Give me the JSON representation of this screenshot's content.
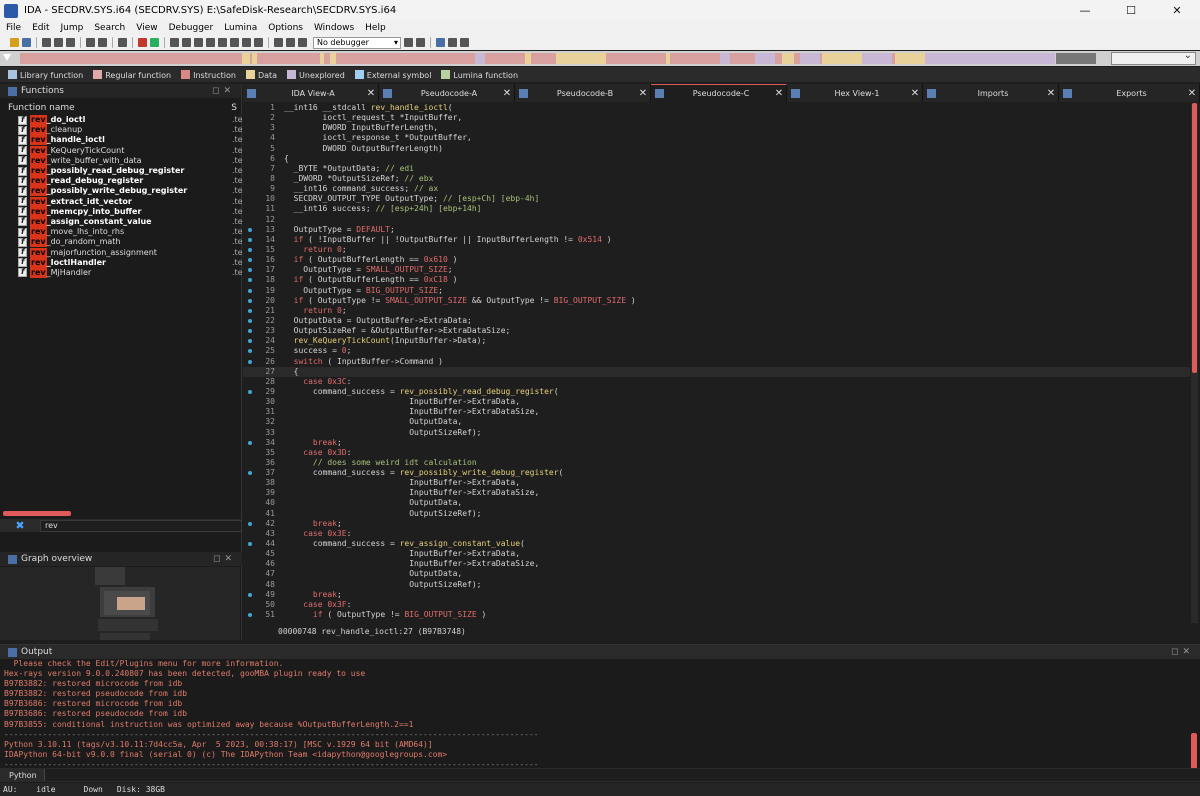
{
  "window": {
    "title": "IDA - SECDRV.SYS.i64 (SECDRV.SYS) E:\\SafeDisk-Research\\SECDRV.SYS.i64",
    "minimize": "—",
    "maximize": "☐",
    "close": "✕"
  },
  "menu": [
    "File",
    "Edit",
    "Jump",
    "Search",
    "View",
    "Debugger",
    "Lumina",
    "Options",
    "Windows",
    "Help"
  ],
  "toolbar": {
    "debugger_select": "No debugger"
  },
  "legend": [
    {
      "label": "Library function",
      "color": "#a9c4e0"
    },
    {
      "label": "Regular function",
      "color": "#e0a8a8"
    },
    {
      "label": "Instruction",
      "color": "#d88a86"
    },
    {
      "label": "Data",
      "color": "#e8d29a"
    },
    {
      "label": "Unexplored",
      "color": "#c9b7d6"
    },
    {
      "label": "External symbol",
      "color": "#9fd0f0"
    },
    {
      "label": "Lumina function",
      "color": "#b7d3a0"
    }
  ],
  "functions_pane": {
    "title": "Functions",
    "col_name": "Function name",
    "col_segment": "S",
    "filter_text": "rev",
    "items": [
      {
        "prefix": "rev",
        "rest": "_do_ioctl",
        "bold": true,
        "seg": ".te"
      },
      {
        "prefix": "rev",
        "rest": "_cleanup",
        "bold": false,
        "seg": ".te"
      },
      {
        "prefix": "rev",
        "rest": "_handle_ioctl",
        "bold": true,
        "seg": ".te"
      },
      {
        "prefix": "rev",
        "rest": "_KeQueryTickCount",
        "bold": false,
        "seg": ".te"
      },
      {
        "prefix": "rev",
        "rest": "_write_buffer_with_data",
        "bold": false,
        "seg": ".te"
      },
      {
        "prefix": "rev",
        "rest": "_possibly_read_debug_register",
        "bold": true,
        "seg": ".te"
      },
      {
        "prefix": "rev",
        "rest": "_read_debug_register",
        "bold": true,
        "seg": ".te"
      },
      {
        "prefix": "rev",
        "rest": "_possibly_write_debug_register",
        "bold": true,
        "seg": ".te"
      },
      {
        "prefix": "rev",
        "rest": "_extract_idt_vector",
        "bold": true,
        "seg": ".te"
      },
      {
        "prefix": "rev",
        "rest": "_memcpy_into_buffer",
        "bold": true,
        "seg": ".te"
      },
      {
        "prefix": "rev",
        "rest": "_assign_constant_value",
        "bold": true,
        "seg": ".te"
      },
      {
        "prefix": "rev",
        "rest": "_move_lhs_into_rhs",
        "bold": false,
        "seg": ".te"
      },
      {
        "prefix": "rev",
        "rest": "_do_random_math",
        "bold": false,
        "seg": ".te"
      },
      {
        "prefix": "rev",
        "rest": "_majorfunction_assignment",
        "bold": false,
        "seg": ".te"
      },
      {
        "prefix": "rev",
        "rest": "_IoctlHandler",
        "bold": true,
        "seg": ".te"
      },
      {
        "prefix": "rev",
        "rest": "_MjHandler",
        "bold": false,
        "seg": ".te"
      }
    ]
  },
  "graph_overview": {
    "title": "Graph overview"
  },
  "tabs": [
    {
      "label": "IDA View-A",
      "active": false
    },
    {
      "label": "Pseudocode-A",
      "active": false
    },
    {
      "label": "Pseudocode-B",
      "active": false
    },
    {
      "label": "Pseudocode-C",
      "active": true
    },
    {
      "label": "Hex View-1",
      "active": false
    },
    {
      "label": "Imports",
      "active": false
    },
    {
      "label": "Exports",
      "active": false
    }
  ],
  "code": {
    "lines": [
      {
        "n": "1",
        "dot": false,
        "t": "__int16 __stdcall rev_handle_ioctl("
      },
      {
        "n": "2",
        "dot": false,
        "t": "        ioctl_request_t *InputBuffer,"
      },
      {
        "n": "3",
        "dot": false,
        "t": "        DWORD InputBufferLength,"
      },
      {
        "n": "4",
        "dot": false,
        "t": "        ioctl_response_t *OutputBuffer,"
      },
      {
        "n": "5",
        "dot": false,
        "t": "        DWORD OutputBufferLength)"
      },
      {
        "n": "6",
        "dot": false,
        "t": "{"
      },
      {
        "n": "7",
        "dot": false,
        "t": "  _BYTE *OutputData; // edi"
      },
      {
        "n": "8",
        "dot": false,
        "t": "  _DWORD *OutputSizeRef; // ebx"
      },
      {
        "n": "9",
        "dot": false,
        "t": "  __int16 command_success; // ax"
      },
      {
        "n": "10",
        "dot": false,
        "t": "  SECDRV_OUTPUT_TYPE OutputType; // [esp+Ch] [ebp-4h]"
      },
      {
        "n": "11",
        "dot": false,
        "t": "  __int16 success; // [esp+24h] [ebp+14h]"
      },
      {
        "n": "12",
        "dot": false,
        "t": ""
      },
      {
        "n": "13",
        "dot": true,
        "t": "  OutputType = DEFAULT;"
      },
      {
        "n": "14",
        "dot": true,
        "t": "  if ( !InputBuffer || !OutputBuffer || InputBufferLength != 0x514 )"
      },
      {
        "n": "15",
        "dot": true,
        "t": "    return 0;"
      },
      {
        "n": "16",
        "dot": true,
        "t": "  if ( OutputBufferLength == 0x610 )"
      },
      {
        "n": "17",
        "dot": true,
        "t": "    OutputType = SMALL_OUTPUT_SIZE;"
      },
      {
        "n": "18",
        "dot": true,
        "t": "  if ( OutputBufferLength == 0xC18 )"
      },
      {
        "n": "19",
        "dot": true,
        "t": "    OutputType = BIG_OUTPUT_SIZE;"
      },
      {
        "n": "20",
        "dot": true,
        "t": "  if ( OutputType != SMALL_OUTPUT_SIZE && OutputType != BIG_OUTPUT_SIZE )"
      },
      {
        "n": "21",
        "dot": true,
        "t": "    return 0;"
      },
      {
        "n": "22",
        "dot": true,
        "t": "  OutputData = OutputBuffer->ExtraData;"
      },
      {
        "n": "23",
        "dot": true,
        "t": "  OutputSizeRef = &OutputBuffer->ExtraDataSize;"
      },
      {
        "n": "24",
        "dot": true,
        "t": "  rev_KeQueryTickCount(InputBuffer->Data);"
      },
      {
        "n": "25",
        "dot": true,
        "t": "  success = 0;"
      },
      {
        "n": "26",
        "dot": true,
        "t": "  switch ( InputBuffer->Command )"
      },
      {
        "n": "27",
        "dot": false,
        "t": "  {"
      },
      {
        "n": "28",
        "dot": false,
        "t": "    case 0x3C:"
      },
      {
        "n": "29",
        "dot": true,
        "t": "      command_success = rev_possibly_read_debug_register("
      },
      {
        "n": "30",
        "dot": false,
        "t": "                          InputBuffer->ExtraData,"
      },
      {
        "n": "31",
        "dot": false,
        "t": "                          InputBuffer->ExtraDataSize,"
      },
      {
        "n": "32",
        "dot": false,
        "t": "                          OutputData,"
      },
      {
        "n": "33",
        "dot": false,
        "t": "                          OutputSizeRef);"
      },
      {
        "n": "34",
        "dot": true,
        "t": "      break;"
      },
      {
        "n": "35",
        "dot": false,
        "t": "    case 0x3D:"
      },
      {
        "n": "36",
        "dot": false,
        "t": "      // does some weird idt calculation"
      },
      {
        "n": "37",
        "dot": true,
        "t": "      command_success = rev_possibly_write_debug_register("
      },
      {
        "n": "38",
        "dot": false,
        "t": "                          InputBuffer->ExtraData,"
      },
      {
        "n": "39",
        "dot": false,
        "t": "                          InputBuffer->ExtraDataSize,"
      },
      {
        "n": "40",
        "dot": false,
        "t": "                          OutputData,"
      },
      {
        "n": "41",
        "dot": false,
        "t": "                          OutputSizeRef);"
      },
      {
        "n": "42",
        "dot": true,
        "t": "      break;"
      },
      {
        "n": "43",
        "dot": false,
        "t": "    case 0x3E:"
      },
      {
        "n": "44",
        "dot": true,
        "t": "      command_success = rev_assign_constant_value("
      },
      {
        "n": "45",
        "dot": false,
        "t": "                          InputBuffer->ExtraData,"
      },
      {
        "n": "46",
        "dot": false,
        "t": "                          InputBuffer->ExtraDataSize,"
      },
      {
        "n": "47",
        "dot": false,
        "t": "                          OutputData,"
      },
      {
        "n": "48",
        "dot": false,
        "t": "                          OutputSizeRef);"
      },
      {
        "n": "49",
        "dot": true,
        "t": "      break;"
      },
      {
        "n": "50",
        "dot": false,
        "t": "    case 0x3F:"
      },
      {
        "n": "51",
        "dot": true,
        "t": "      if ( OutputType != BIG_OUTPUT_SIZE )"
      }
    ],
    "current_line": "27",
    "status": "00000748 rev_handle_ioctl:27 (B97B3748)"
  },
  "output": {
    "title": "Output",
    "lines": [
      {
        "t": "  Please check the Edit/Plugins menu for more information.",
        "dim": false
      },
      {
        "t": "Hex-rays version 9.0.0.240807 has been detected, gooMBA plugin ready to use",
        "dim": false
      },
      {
        "t": "B97B3882: restored microcode from idb",
        "dim": false
      },
      {
        "t": "B97B3882: restored pseudocode from idb",
        "dim": false
      },
      {
        "t": "B97B3686: restored microcode from idb",
        "dim": false
      },
      {
        "t": "B97B3686: restored pseudocode from idb",
        "dim": false
      },
      {
        "t": "B97B3855: conditional instruction was optimized away because %OutputBufferLength.2==1",
        "dim": false
      },
      {
        "t": "---------------------------------------------------------------------------------------------------------------",
        "dim": true
      },
      {
        "t": "Python 3.10.11 (tags/v3.10.11:7d4cc5a, Apr  5 2023, 00:38:17) [MSC v.1929 64 bit (AMD64)]",
        "dim": false
      },
      {
        "t": "IDAPython 64-bit v9.0.0 final (serial 0) (c) The IDAPython Team <idapython@googlegroups.com>",
        "dim": false
      },
      {
        "t": "---------------------------------------------------------------------------------------------------------------",
        "dim": true
      }
    ]
  },
  "python_bar": {
    "label": "Python"
  },
  "statusbar": {
    "au_label": "AU:",
    "au_state": "idle",
    "direction": "Down",
    "disk": "Disk: 38GB"
  }
}
